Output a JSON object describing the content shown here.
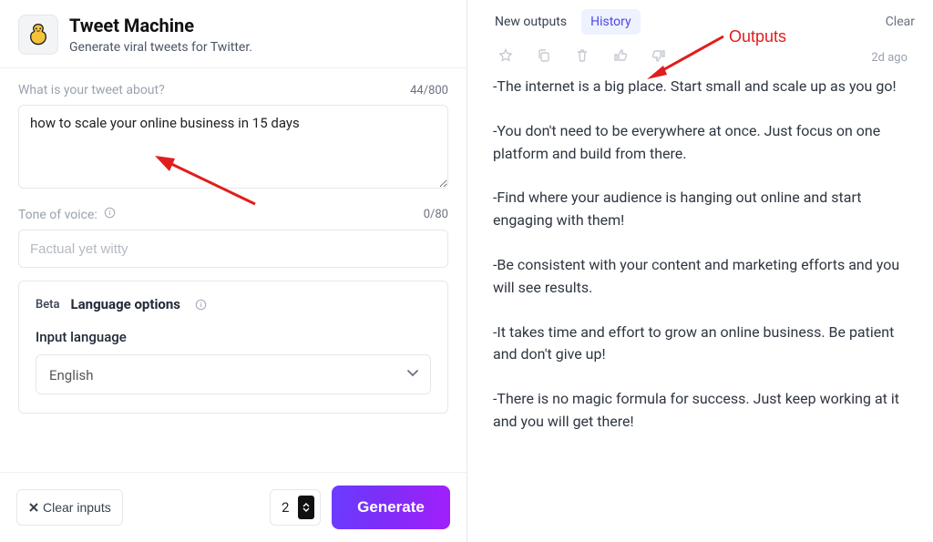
{
  "header": {
    "title": "Tweet Machine",
    "subtitle": "Generate viral tweets for Twitter."
  },
  "prompt_field": {
    "label": "What is your tweet about?",
    "value": "how to scale your online business in 15 days",
    "counter": "44/800"
  },
  "tone_field": {
    "label": "Tone of voice:",
    "placeholder": "Factual yet witty",
    "counter": "0/80"
  },
  "language_options": {
    "beta": "Beta",
    "heading": "Language options",
    "input_label": "Input language",
    "selected": "English"
  },
  "footer": {
    "clear_btn": "Clear inputs",
    "count_value": "2",
    "generate_btn": "Generate"
  },
  "right": {
    "tab_new": "New outputs",
    "tab_history": "History",
    "clear_link": "Clear",
    "timestamp": "2d ago"
  },
  "outputs": [
    "-The internet is a big place. Start small and scale up as you go!",
    "-You don't need to be everywhere at once. Just focus on one platform and build from there.",
    "-Find where your audience is hanging out online and start engaging with them!",
    "-Be consistent with your content and marketing efforts and you will see results.",
    "-It takes time and effort to grow an online business. Be patient and don't give up!",
    "-There is no magic formula for success. Just keep working at it and you will get there!"
  ],
  "annotation_label": "Outputs"
}
